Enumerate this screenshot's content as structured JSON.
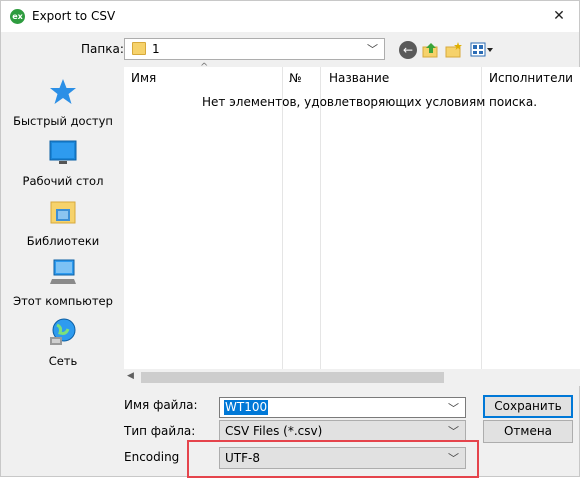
{
  "window": {
    "title": "Export to CSV",
    "app_icon_text": "ex",
    "close_glyph": "✕"
  },
  "lookin": {
    "label": "Папка:",
    "value": "1",
    "icon": "folder-icon"
  },
  "toolbar": {
    "back_icon": "back-arrow-icon",
    "up_icon": "up-folder-icon",
    "new_folder_icon": "new-folder-icon",
    "views_icon": "view-menu-icon"
  },
  "places": [
    {
      "label": "Быстрый доступ",
      "icon": "star-icon"
    },
    {
      "label": "Рабочий стол",
      "icon": "desktop-icon"
    },
    {
      "label": "Библиотеки",
      "icon": "libraries-icon"
    },
    {
      "label": "Этот компьютер",
      "icon": "computer-icon"
    },
    {
      "label": "Сеть",
      "icon": "network-icon"
    }
  ],
  "filelist": {
    "columns": [
      "Имя",
      "№",
      "Название",
      "Исполнители"
    ],
    "sort_glyph": "^",
    "empty_message": "Нет элементов, удовлетворяющих условиям поиска."
  },
  "form": {
    "filename_label": "Имя файла:",
    "filename_value": "WT100",
    "filetype_label": "Тип файла:",
    "filetype_value": "CSV Files (*.csv)",
    "encoding_label": "Encoding",
    "encoding_value": "UTF-8"
  },
  "buttons": {
    "save": "Сохранить",
    "cancel": "Отмена"
  },
  "colors": {
    "highlight": "#e5444c",
    "selection": "#0078d7",
    "accent_star": "#2b8fe6"
  }
}
